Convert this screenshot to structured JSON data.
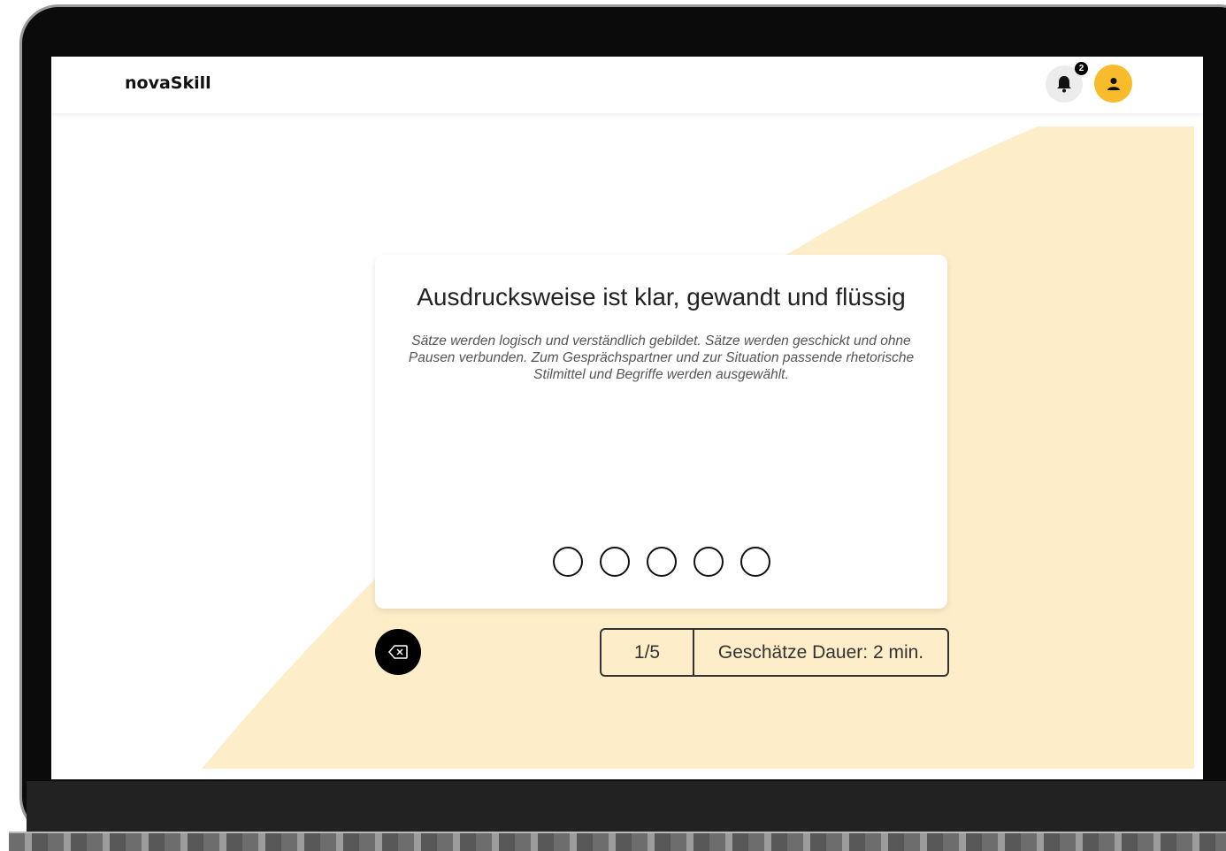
{
  "app": {
    "logo": "novaSkill",
    "notification_count": "2",
    "accent_color": "#f7bb2b",
    "background_color": "#fdeec9"
  },
  "icons": {
    "notifications": "bell-icon",
    "profile": "user-icon",
    "back": "backspace-icon"
  },
  "question": {
    "title": "Ausdrucksweise ist klar, gewandt und flüssig",
    "description": "Sätze werden logisch und verständlich gebildet. Sätze werden geschickt und ohne Pausen verbunden. Zum Gesprächspartner und zur Situation passende rhetorische Stilmittel und Begriffe werden ausgewählt.",
    "rating_options": 5,
    "selected_rating": null
  },
  "footer": {
    "progress": "1/5",
    "duration": "Geschätze Dauer: 2 min."
  }
}
